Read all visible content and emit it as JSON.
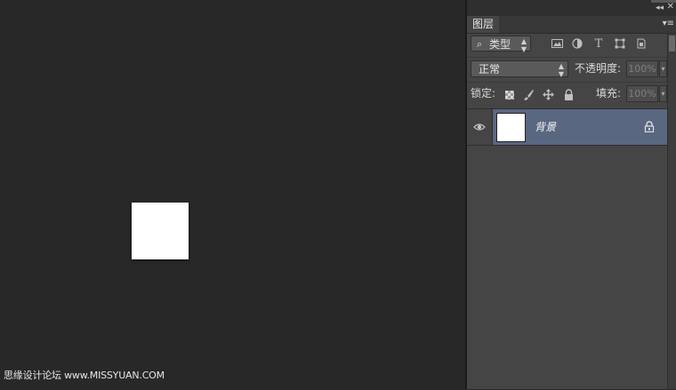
{
  "window": {
    "collapse_glyph": "◂◂",
    "close_glyph": "✕",
    "menu_glyph": "▾≡"
  },
  "panel": {
    "tab_label": "图层",
    "filter": {
      "search_glyph": "⌕",
      "kind_label": "类型",
      "icons": [
        "image-filter-icon",
        "adjustment-filter-icon",
        "type-filter-icon",
        "shape-filter-icon",
        "smart-object-filter-icon"
      ]
    },
    "blend": {
      "mode": "正常",
      "opacity_label": "不透明度:",
      "opacity_value": "100%"
    },
    "lock": {
      "label": "锁定:",
      "icons": [
        "lock-transparent-pixels-icon",
        "lock-image-pixels-icon",
        "lock-position-icon",
        "lock-all-icon"
      ],
      "fill_label": "填充:",
      "fill_value": "100%"
    },
    "layers": [
      {
        "name": "背景",
        "visible": true,
        "locked": true,
        "selected": true
      }
    ]
  },
  "watermark": {
    "text": "思缘设计论坛 www.MISSYUAN.COM"
  },
  "colors": {
    "workspace": "#282828",
    "panel": "#454545",
    "selected_layer": "#5a6781",
    "canvas": "#ffffff"
  }
}
